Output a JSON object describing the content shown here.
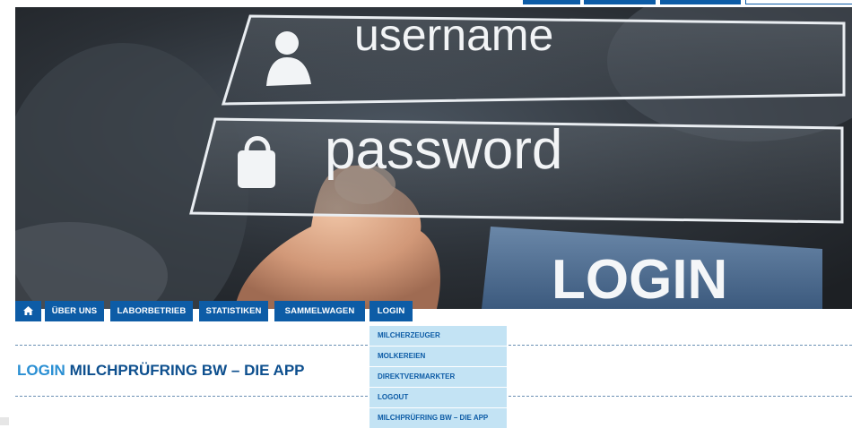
{
  "hero": {
    "username_text": "username",
    "password_text": "password",
    "login_text": "LOGIN"
  },
  "nav": {
    "home_icon": "home-icon",
    "items": [
      {
        "label": "ÜBER UNS"
      },
      {
        "label": "LABORBETRIEB"
      },
      {
        "label": "STATISTIKEN"
      },
      {
        "label": "SAMMELWAGEN"
      },
      {
        "label": "LOGIN"
      }
    ]
  },
  "dropdown": {
    "items": [
      {
        "label": "MILCHERZEUGER"
      },
      {
        "label": "MOLKEREIEN"
      },
      {
        "label": "DIREKTVERMARKTER"
      },
      {
        "label": "LOGOUT"
      },
      {
        "label": "MILCHPRÜFRING BW – DIE APP"
      }
    ]
  },
  "page": {
    "title_accent": "LOGIN",
    "title_rest": " MILCHPRÜFRING BW – DIE APP"
  },
  "colors": {
    "brand_blue": "#0d5ca6",
    "dropdown_bg": "#c3e3f4",
    "title_blue": "#0d4f8e",
    "title_accent": "#2a8fd3"
  }
}
